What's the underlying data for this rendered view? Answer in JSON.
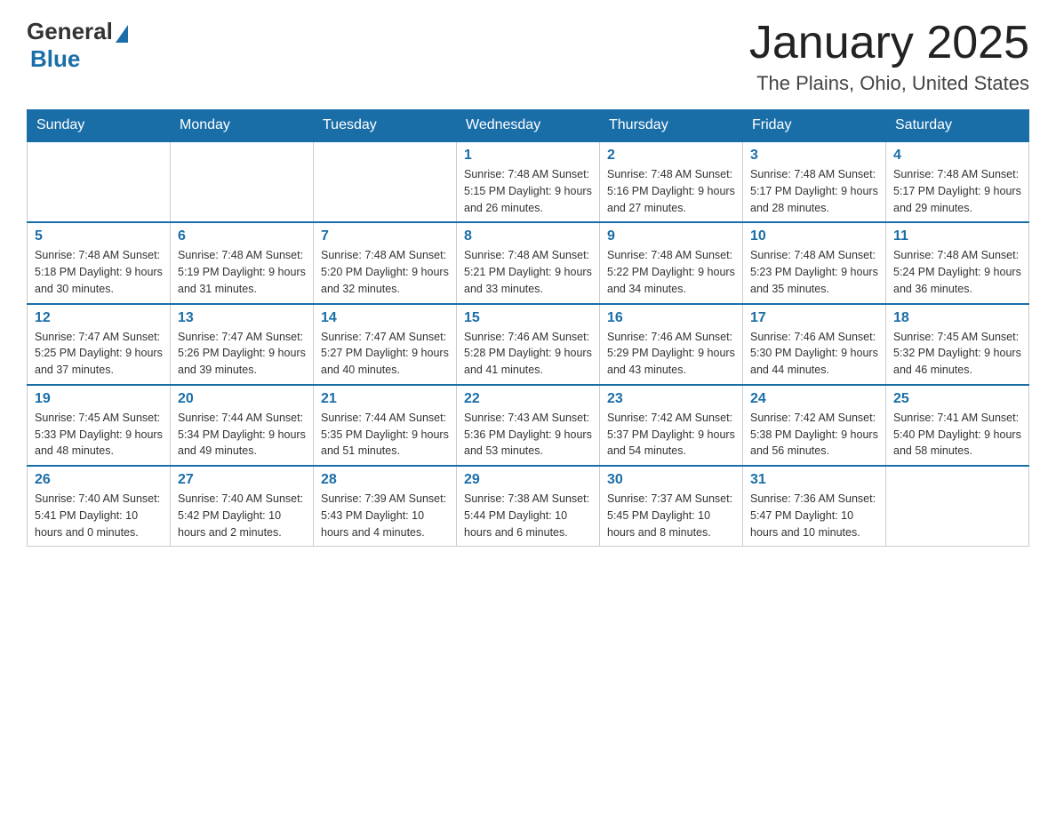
{
  "header": {
    "logo_general": "General",
    "logo_blue": "Blue",
    "month_year": "January 2025",
    "location": "The Plains, Ohio, United States"
  },
  "days_of_week": [
    "Sunday",
    "Monday",
    "Tuesday",
    "Wednesday",
    "Thursday",
    "Friday",
    "Saturday"
  ],
  "weeks": [
    [
      {
        "day": "",
        "info": ""
      },
      {
        "day": "",
        "info": ""
      },
      {
        "day": "",
        "info": ""
      },
      {
        "day": "1",
        "info": "Sunrise: 7:48 AM\nSunset: 5:15 PM\nDaylight: 9 hours\nand 26 minutes."
      },
      {
        "day": "2",
        "info": "Sunrise: 7:48 AM\nSunset: 5:16 PM\nDaylight: 9 hours\nand 27 minutes."
      },
      {
        "day": "3",
        "info": "Sunrise: 7:48 AM\nSunset: 5:17 PM\nDaylight: 9 hours\nand 28 minutes."
      },
      {
        "day": "4",
        "info": "Sunrise: 7:48 AM\nSunset: 5:17 PM\nDaylight: 9 hours\nand 29 minutes."
      }
    ],
    [
      {
        "day": "5",
        "info": "Sunrise: 7:48 AM\nSunset: 5:18 PM\nDaylight: 9 hours\nand 30 minutes."
      },
      {
        "day": "6",
        "info": "Sunrise: 7:48 AM\nSunset: 5:19 PM\nDaylight: 9 hours\nand 31 minutes."
      },
      {
        "day": "7",
        "info": "Sunrise: 7:48 AM\nSunset: 5:20 PM\nDaylight: 9 hours\nand 32 minutes."
      },
      {
        "day": "8",
        "info": "Sunrise: 7:48 AM\nSunset: 5:21 PM\nDaylight: 9 hours\nand 33 minutes."
      },
      {
        "day": "9",
        "info": "Sunrise: 7:48 AM\nSunset: 5:22 PM\nDaylight: 9 hours\nand 34 minutes."
      },
      {
        "day": "10",
        "info": "Sunrise: 7:48 AM\nSunset: 5:23 PM\nDaylight: 9 hours\nand 35 minutes."
      },
      {
        "day": "11",
        "info": "Sunrise: 7:48 AM\nSunset: 5:24 PM\nDaylight: 9 hours\nand 36 minutes."
      }
    ],
    [
      {
        "day": "12",
        "info": "Sunrise: 7:47 AM\nSunset: 5:25 PM\nDaylight: 9 hours\nand 37 minutes."
      },
      {
        "day": "13",
        "info": "Sunrise: 7:47 AM\nSunset: 5:26 PM\nDaylight: 9 hours\nand 39 minutes."
      },
      {
        "day": "14",
        "info": "Sunrise: 7:47 AM\nSunset: 5:27 PM\nDaylight: 9 hours\nand 40 minutes."
      },
      {
        "day": "15",
        "info": "Sunrise: 7:46 AM\nSunset: 5:28 PM\nDaylight: 9 hours\nand 41 minutes."
      },
      {
        "day": "16",
        "info": "Sunrise: 7:46 AM\nSunset: 5:29 PM\nDaylight: 9 hours\nand 43 minutes."
      },
      {
        "day": "17",
        "info": "Sunrise: 7:46 AM\nSunset: 5:30 PM\nDaylight: 9 hours\nand 44 minutes."
      },
      {
        "day": "18",
        "info": "Sunrise: 7:45 AM\nSunset: 5:32 PM\nDaylight: 9 hours\nand 46 minutes."
      }
    ],
    [
      {
        "day": "19",
        "info": "Sunrise: 7:45 AM\nSunset: 5:33 PM\nDaylight: 9 hours\nand 48 minutes."
      },
      {
        "day": "20",
        "info": "Sunrise: 7:44 AM\nSunset: 5:34 PM\nDaylight: 9 hours\nand 49 minutes."
      },
      {
        "day": "21",
        "info": "Sunrise: 7:44 AM\nSunset: 5:35 PM\nDaylight: 9 hours\nand 51 minutes."
      },
      {
        "day": "22",
        "info": "Sunrise: 7:43 AM\nSunset: 5:36 PM\nDaylight: 9 hours\nand 53 minutes."
      },
      {
        "day": "23",
        "info": "Sunrise: 7:42 AM\nSunset: 5:37 PM\nDaylight: 9 hours\nand 54 minutes."
      },
      {
        "day": "24",
        "info": "Sunrise: 7:42 AM\nSunset: 5:38 PM\nDaylight: 9 hours\nand 56 minutes."
      },
      {
        "day": "25",
        "info": "Sunrise: 7:41 AM\nSunset: 5:40 PM\nDaylight: 9 hours\nand 58 minutes."
      }
    ],
    [
      {
        "day": "26",
        "info": "Sunrise: 7:40 AM\nSunset: 5:41 PM\nDaylight: 10 hours\nand 0 minutes."
      },
      {
        "day": "27",
        "info": "Sunrise: 7:40 AM\nSunset: 5:42 PM\nDaylight: 10 hours\nand 2 minutes."
      },
      {
        "day": "28",
        "info": "Sunrise: 7:39 AM\nSunset: 5:43 PM\nDaylight: 10 hours\nand 4 minutes."
      },
      {
        "day": "29",
        "info": "Sunrise: 7:38 AM\nSunset: 5:44 PM\nDaylight: 10 hours\nand 6 minutes."
      },
      {
        "day": "30",
        "info": "Sunrise: 7:37 AM\nSunset: 5:45 PM\nDaylight: 10 hours\nand 8 minutes."
      },
      {
        "day": "31",
        "info": "Sunrise: 7:36 AM\nSunset: 5:47 PM\nDaylight: 10 hours\nand 10 minutes."
      },
      {
        "day": "",
        "info": ""
      }
    ]
  ]
}
